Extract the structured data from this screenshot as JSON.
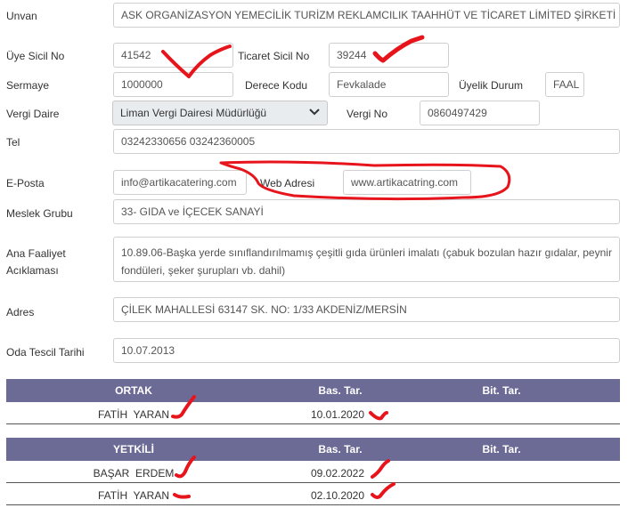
{
  "form": {
    "unvan": {
      "label": "Unvan",
      "value": "ASK ORGANİZASYON YEMECİLİK TURİZM REKLAMCILIK TAAHHÜT VE TİCARET LİMİTED ŞİRKETİ"
    },
    "uye_sicil_no": {
      "label": "Üye Sicil No",
      "value": "41542"
    },
    "ticaret_sicil_no": {
      "label": "Ticaret Sicil No",
      "value": "39244"
    },
    "sermaye": {
      "label": "Sermaye",
      "value": "1000000"
    },
    "derece_kodu": {
      "label": "Derece Kodu",
      "value": "Fevkalade"
    },
    "uyelik_durum": {
      "label": "Üyelik Durum",
      "value": "FAAL"
    },
    "vergi_daire": {
      "label": "Vergi Daire",
      "value": "Liman Vergi Dairesi Müdürlüğü"
    },
    "vergi_no": {
      "label": "Vergi No",
      "value": "0860497429"
    },
    "tel": {
      "label": "Tel",
      "value": "03242330656 03242360005"
    },
    "eposta": {
      "label": "E-Posta",
      "value": "info@artikacatering.com"
    },
    "web_adresi": {
      "label": "Web Adresi",
      "value": "www.artikacatring.com"
    },
    "meslek_grubu": {
      "label": "Meslek Grubu",
      "value": "33- GIDA ve İÇECEK SANAYİ"
    },
    "ana_faaliyet": {
      "label_line1": "Ana Faaliyet",
      "label_line2": "Acıklaması",
      "value": "10.89.06-Başka yerde sınıflandırılmamış çeşitli gıda ürünleri imalatı (çabuk bozulan hazır gıdalar, peynir fondüleri, şeker şurupları vb. dahil)"
    },
    "adres": {
      "label": "Adres",
      "value": "ÇİLEK MAHALLESİ 63147 SK. NO: 1/33 AKDENİZ/MERSİN"
    },
    "oda_tescil_tarihi": {
      "label": "Oda Tescil Tarihi",
      "value": "10.07.2013"
    }
  },
  "ortak_table": {
    "headers": [
      "ORTAK",
      "Bas. Tar.",
      "Bit. Tar."
    ],
    "rows": [
      {
        "name": "FATİH  YARAN",
        "bas": "10.01.2020",
        "bit": ""
      }
    ]
  },
  "yetkili_table": {
    "headers": [
      "YETKİLİ",
      "Bas. Tar.",
      "Bit. Tar."
    ],
    "rows": [
      {
        "name": "BAŞAR  ERDEM",
        "bas": "09.02.2022",
        "bit": ""
      },
      {
        "name": "FATİH  YARAN",
        "bas": "02.10.2020",
        "bit": ""
      }
    ]
  },
  "colors": {
    "table_header": "#6c6b96",
    "annotation": "#e8141c",
    "select_bg": "#e9ecef"
  },
  "icons": {
    "select_chevron": "chevron-down-icon"
  }
}
